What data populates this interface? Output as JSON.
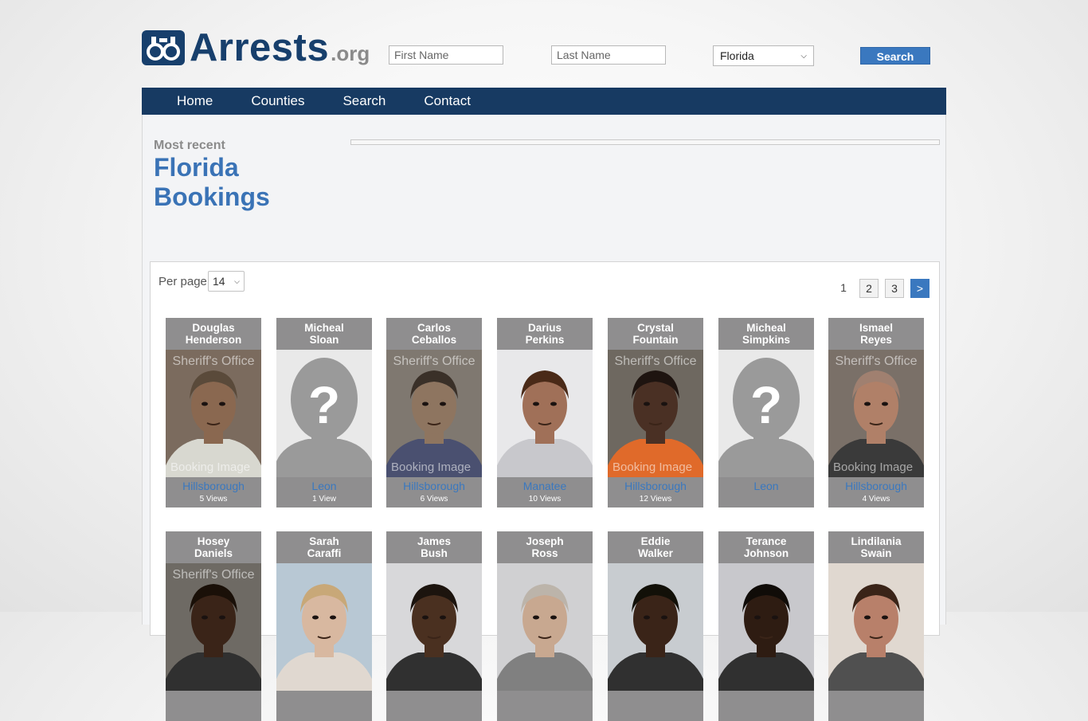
{
  "header": {
    "logo_main": "Arrests",
    "logo_ext": ".org",
    "first_name_placeholder": "First Name",
    "last_name_placeholder": "Last Name",
    "state_selected": "Florida",
    "search_label": "Search"
  },
  "nav": [
    "Home",
    "Counties",
    "Search",
    "Contact"
  ],
  "intro": {
    "eyebrow": "Most recent",
    "title_line1": "Florida",
    "title_line2": "Bookings"
  },
  "listing": {
    "per_page_label": "Per page",
    "per_page_value": "14",
    "pages": [
      "1",
      "2",
      "3"
    ],
    "current_page": "1",
    "next_label": ">"
  },
  "colors": {
    "brand": "#173f6c",
    "nav_bg": "#173a62",
    "accent": "#3a78bf",
    "card_bg": "#8f8e8f"
  },
  "bookings": [
    {
      "first": "Douglas",
      "last": "Henderson",
      "county": "Hillsborough",
      "views": "5 Views",
      "photo": "mugshot",
      "wm_top": "Sheriff's Office",
      "wm_bottom": "Booking Image",
      "skin": "#8a6850",
      "hair": "#5a4a3a",
      "shirt": "#d8d8d0",
      "bg": "#7b6b5e"
    },
    {
      "first": "Micheal",
      "last": "Sloan",
      "county": "Leon",
      "views": "1 View",
      "photo": "placeholder"
    },
    {
      "first": "Carlos",
      "last": "Ceballos",
      "county": "Hillsborough",
      "views": "6 Views",
      "photo": "mugshot",
      "wm_top": "Sheriff's Office",
      "wm_bottom": "Booking Image",
      "skin": "#8e7560",
      "hair": "#3a3028",
      "shirt": "#4a5070",
      "bg": "#7f7870"
    },
    {
      "first": "Darius",
      "last": "Perkins",
      "county": "Manatee",
      "views": "10 Views",
      "photo": "mugshot",
      "wm_top": "",
      "wm_bottom": "",
      "skin": "#a07058",
      "hair": "#4a2a18",
      "shirt": "#c8c8cc",
      "bg": "#e8e8ea"
    },
    {
      "first": "Crystal",
      "last": "Fountain",
      "county": "Hillsborough",
      "views": "12 Views",
      "photo": "mugshot",
      "wm_top": "Sheriff's Office",
      "wm_bottom": "Booking Image",
      "skin": "#4a3024",
      "hair": "#1e1410",
      "shirt": "#e06a2a",
      "bg": "#6e6860"
    },
    {
      "first": "Micheal",
      "last": "Simpkins",
      "county": "Leon",
      "views": "",
      "photo": "placeholder"
    },
    {
      "first": "Ismael",
      "last": "Reyes",
      "county": "Hillsborough",
      "views": "4 Views",
      "photo": "mugshot",
      "wm_top": "Sheriff's Office",
      "wm_bottom": "Booking Image",
      "skin": "#b08068",
      "hair": "#a08070",
      "shirt": "#3a3a3a",
      "bg": "#7a7068"
    },
    {
      "first": "Hosey",
      "last": "Daniels",
      "county": "",
      "views": "",
      "photo": "mugshot",
      "wm_top": "Sheriff's Office",
      "wm_bottom": "",
      "skin": "#3a2418",
      "hair": "#1a1008",
      "shirt": "#303030",
      "bg": "#6e6a64"
    },
    {
      "first": "Sarah",
      "last": "Caraffi",
      "county": "",
      "views": "",
      "photo": "mugshot",
      "wm_top": "",
      "wm_bottom": "",
      "skin": "#d8b8a0",
      "hair": "#c8a878",
      "shirt": "#e0d8d0",
      "bg": "#b8c8d4"
    },
    {
      "first": "James",
      "last": "Bush",
      "county": "",
      "views": "",
      "photo": "mugshot",
      "wm_top": "",
      "wm_bottom": "",
      "skin": "#4a3020",
      "hair": "#1c140e",
      "shirt": "#303030",
      "bg": "#d8d8da"
    },
    {
      "first": "Joseph",
      "last": "Ross",
      "county": "",
      "views": "",
      "photo": "mugshot",
      "wm_top": "",
      "wm_bottom": "",
      "skin": "#c8a890",
      "hair": "#bcb4aa",
      "shirt": "#808080",
      "bg": "#d0d0d2"
    },
    {
      "first": "Eddie",
      "last": "Walker",
      "county": "",
      "views": "",
      "photo": "mugshot",
      "wm_top": "",
      "wm_bottom": "",
      "skin": "#3a2418",
      "hair": "#121008",
      "shirt": "#303030",
      "bg": "#c8ccd0"
    },
    {
      "first": "Terance",
      "last": "Johnson",
      "county": "",
      "views": "",
      "photo": "mugshot",
      "wm_top": "",
      "wm_bottom": "",
      "skin": "#2e1c12",
      "hair": "#100c08",
      "shirt": "#303030",
      "bg": "#c8c8cc"
    },
    {
      "first": "Lindilania",
      "last": "Swain",
      "county": "",
      "views": "",
      "photo": "mugshot",
      "wm_top": "",
      "wm_bottom": "",
      "skin": "#b8806a",
      "hair": "#3a2418",
      "shirt": "#505050",
      "bg": "#e0d8d0"
    }
  ]
}
